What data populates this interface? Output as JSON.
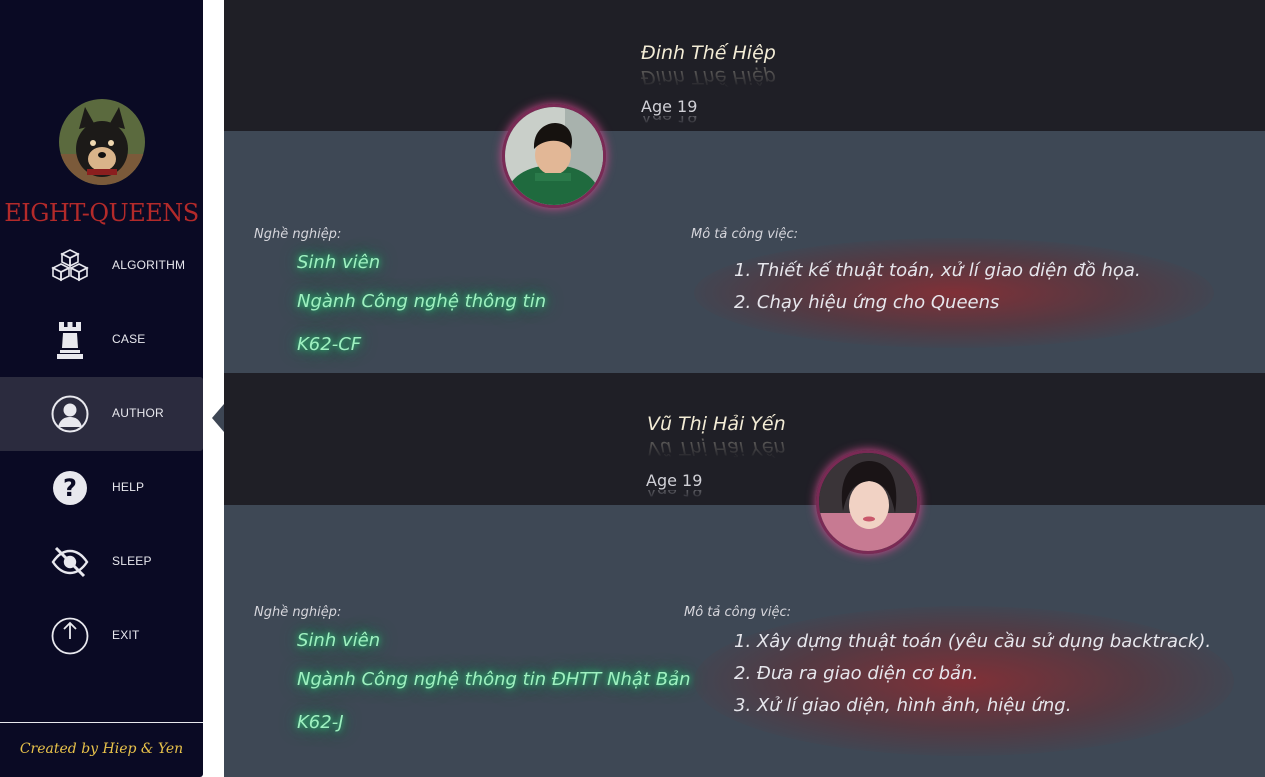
{
  "app": {
    "title": "EIGHT-QUEENS",
    "credit": "Created by Hiep & Yen"
  },
  "nav": {
    "algorithm": "ALGORITHM",
    "case": "CASE",
    "author": "AUTHOR",
    "help": "HELP",
    "sleep": "SLEEP",
    "exit": "EXIT"
  },
  "active_nav": "AUTHOR",
  "authors": [
    {
      "name": "Đinh Thế Hiệp",
      "age": "Age 19",
      "occupation_label": "Nghề nghiệp:",
      "occupation": [
        "Sinh viên",
        "Ngành Công nghệ thông tin",
        "K62-CF"
      ],
      "tasks_label": "Mô tả công việc:",
      "tasks": [
        "1. Thiết kế thuật toán, xử lí giao diện đồ họa.",
        "2. Chạy hiệu ứng cho Queens"
      ]
    },
    {
      "name": "Vũ Thị Hải Yến",
      "age": "Age 19",
      "occupation_label": "Nghề nghiệp:",
      "occupation": [
        "Sinh viên",
        "Ngành Công nghệ thông tin ĐHTT Nhật Bản",
        "K62-J"
      ],
      "tasks_label": "Mô tả công việc:",
      "tasks": [
        "1. Xây dựng thuật toán (yêu cầu sử dụng backtrack).",
        "2. Đưa ra giao diện cơ bản.",
        "3. Xử lí giao diện, hình ảnh, hiệu ứng."
      ]
    }
  ],
  "colors": {
    "sidebar_bg": "#0a0a24",
    "title_red": "#b32a2a",
    "credit_gold": "#e8c24a",
    "occupation_green": "#9ef0c0",
    "panel_bg": "#3e4855",
    "header_bg": "#1f1f26"
  }
}
